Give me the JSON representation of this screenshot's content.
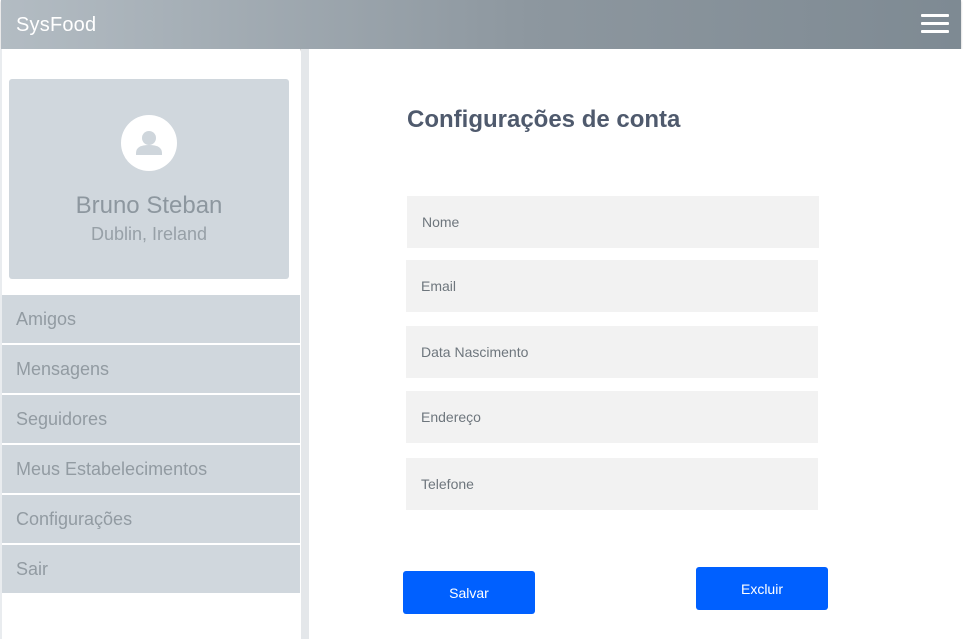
{
  "header": {
    "brand": "SysFood",
    "menu_icon": "hamburger-menu-icon"
  },
  "profile": {
    "avatar_icon": "user-avatar-icon",
    "name": "Bruno Steban",
    "location": "Dublin, Ireland"
  },
  "sidebar": {
    "items": [
      {
        "label": "Amigos"
      },
      {
        "label": "Mensagens"
      },
      {
        "label": "Seguidores"
      },
      {
        "label": "Meus Estabelecimentos"
      },
      {
        "label": "Configurações"
      },
      {
        "label": "Sair"
      }
    ]
  },
  "main": {
    "title": "Configurações de conta",
    "fields": {
      "nome": {
        "placeholder": "Nome",
        "value": ""
      },
      "email": {
        "placeholder": "Email",
        "value": ""
      },
      "nascimento": {
        "placeholder": "Data Nascimento",
        "value": ""
      },
      "endereco": {
        "placeholder": "Endereço",
        "value": ""
      },
      "telefone": {
        "placeholder": "Telefone",
        "value": ""
      }
    },
    "buttons": {
      "save": "Salvar",
      "delete": "Excluir"
    }
  },
  "colors": {
    "primary_button": "#0060ff",
    "card_bg": "#d0d7dd",
    "field_bg": "#f2f2f2",
    "title": "#4f5a6d"
  }
}
